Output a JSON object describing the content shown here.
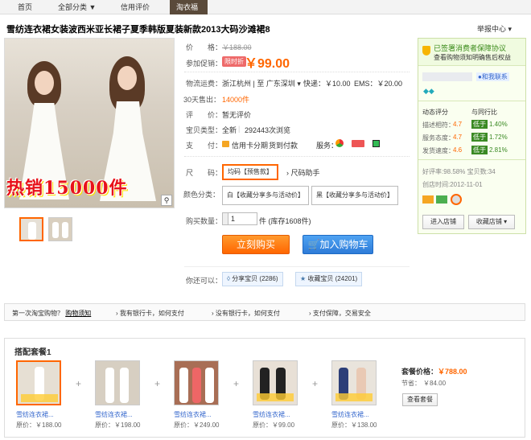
{
  "nav": {
    "items": [
      "首页",
      "全部分类 ▼",
      "信用评价",
      "淘衣福"
    ]
  },
  "title": "雪纺连衣裙女装波西米亚长裙子夏季韩版夏装新款2013大码沙滩裙8",
  "report": "举报中心 ▾",
  "main_image_banner": "热销15000件",
  "price": {
    "label": "价　　格：",
    "original": "￥188.00",
    "promo_label": "参加促销：",
    "promo_badge": "限时折",
    "promo_price": "￥99.00"
  },
  "shipping": {
    "label": "物流运费：",
    "route": "浙江杭州 | 至 广东深圳 ▾",
    "express": "快递：￥10.00",
    "ems": "EMS：￥20.00"
  },
  "sales": {
    "label": "30天售出：",
    "value": "14000件"
  },
  "review": {
    "label": "评　　价：",
    "value": "暂无评价"
  },
  "item_type": {
    "label": "宝贝类型：",
    "value": "全新",
    "views": "292443次浏览"
  },
  "payment": {
    "label": "支　　付：",
    "card": "信用卡分期",
    "cod": "货到付款",
    "service": "服务："
  },
  "size": {
    "label": "尺　　码：",
    "selected": "均码【预售款】",
    "helper": "尺码助手"
  },
  "color": {
    "label": "颜色分类：",
    "options": [
      "白【收藏分享多与活动价】",
      "黑【收藏分享多与活动价】"
    ]
  },
  "quantity": {
    "label": "购买数量：",
    "value": "1",
    "unit": "件 (库存1608件)"
  },
  "buttons": {
    "buy": "立刻购买",
    "cart": "加入购物车"
  },
  "share": {
    "label": "你还可以：",
    "share_btn": "分享宝贝 (2286)",
    "fav_btn": "收藏宝贝 (24201)"
  },
  "side": {
    "signed": "已签署消费者保障协议",
    "notice": "查看购物须知明确售后权益",
    "wangwang": "和我联系",
    "rating_title": "动态评分",
    "compare_title": "与同行比",
    "ratings": [
      {
        "name": "描述相符：",
        "score": "4.7",
        "badge": "低于",
        "pct": "1.40%"
      },
      {
        "name": "服务态度：",
        "score": "4.7",
        "badge": "低于",
        "pct": "1.72%"
      },
      {
        "name": "发货速度：",
        "score": "4.6",
        "badge": "低于",
        "pct": "2.81%"
      }
    ],
    "goodrate": "好评率:98.58% 宝贝数:34",
    "created": "创店时间:2012-11-01",
    "enter_shop": "进入店铺",
    "fav_shop": "收藏店铺 ▾"
  },
  "strip": {
    "first": "第一次淘宝购物？",
    "notice": "购物须知",
    "tips": [
      "我有银行卡，如何支付",
      "没有银行卡，如何支付",
      "支付保障，交易安全"
    ]
  },
  "package": {
    "title": "搭配套餐1",
    "items": [
      {
        "name": "雪纺连衣裙...",
        "price": "原价：￥188.00"
      },
      {
        "name": "雪纺连衣裙...",
        "price": "原价：￥198.00"
      },
      {
        "name": "雪纺连衣裙...",
        "price": "原价：￥249.00"
      },
      {
        "name": "雪纺连衣裙...",
        "price": "原价：￥99.00"
      },
      {
        "name": "雪纺连衣裙...",
        "price": "原价：￥138.00"
      }
    ],
    "price_label": "套餐价格：",
    "price": "￥788.00",
    "save_label": "节省：",
    "save": "￥84.00",
    "view_btn": "查看套餐"
  }
}
